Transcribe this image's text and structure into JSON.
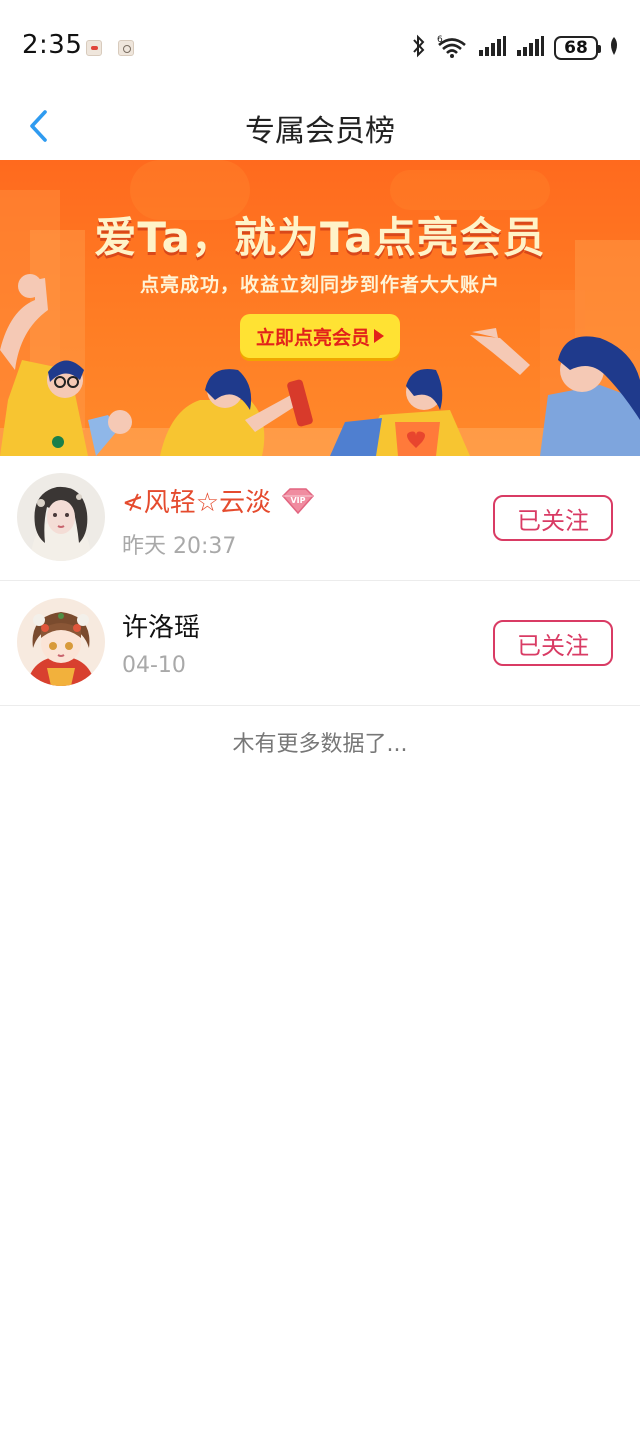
{
  "status_bar": {
    "time": "2:35",
    "battery": "68",
    "icons": [
      "bluetooth-icon",
      "wifi-6-icon",
      "signal-icon",
      "signal-icon",
      "battery-icon",
      "leaf-icon"
    ]
  },
  "nav": {
    "back_icon": "chevron-left-icon",
    "title": "专属会员榜",
    "accent_color": "#2f9bf0"
  },
  "banner": {
    "headline": "爱Ta，就为Ta点亮会员",
    "subtitle": "点亮成功，收益立刻同步到作者大大账户",
    "cta_label": "立即点亮会员",
    "colors": {
      "background": "#ff6a1e",
      "cta_bg": "#ffe233",
      "cta_text": "#e2231a"
    }
  },
  "members": [
    {
      "name": "≮风轻☆云淡",
      "is_vip": true,
      "time": "昨天 20:37",
      "follow_label": "已关注"
    },
    {
      "name": "许洛瑶",
      "is_vip": false,
      "time": "04-10",
      "follow_label": "已关注"
    }
  ],
  "footer_text": "木有更多数据了...",
  "colors": {
    "vip_name": "#e54b2e",
    "follow_border": "#d93b64",
    "muted": "#a9a9a9"
  }
}
